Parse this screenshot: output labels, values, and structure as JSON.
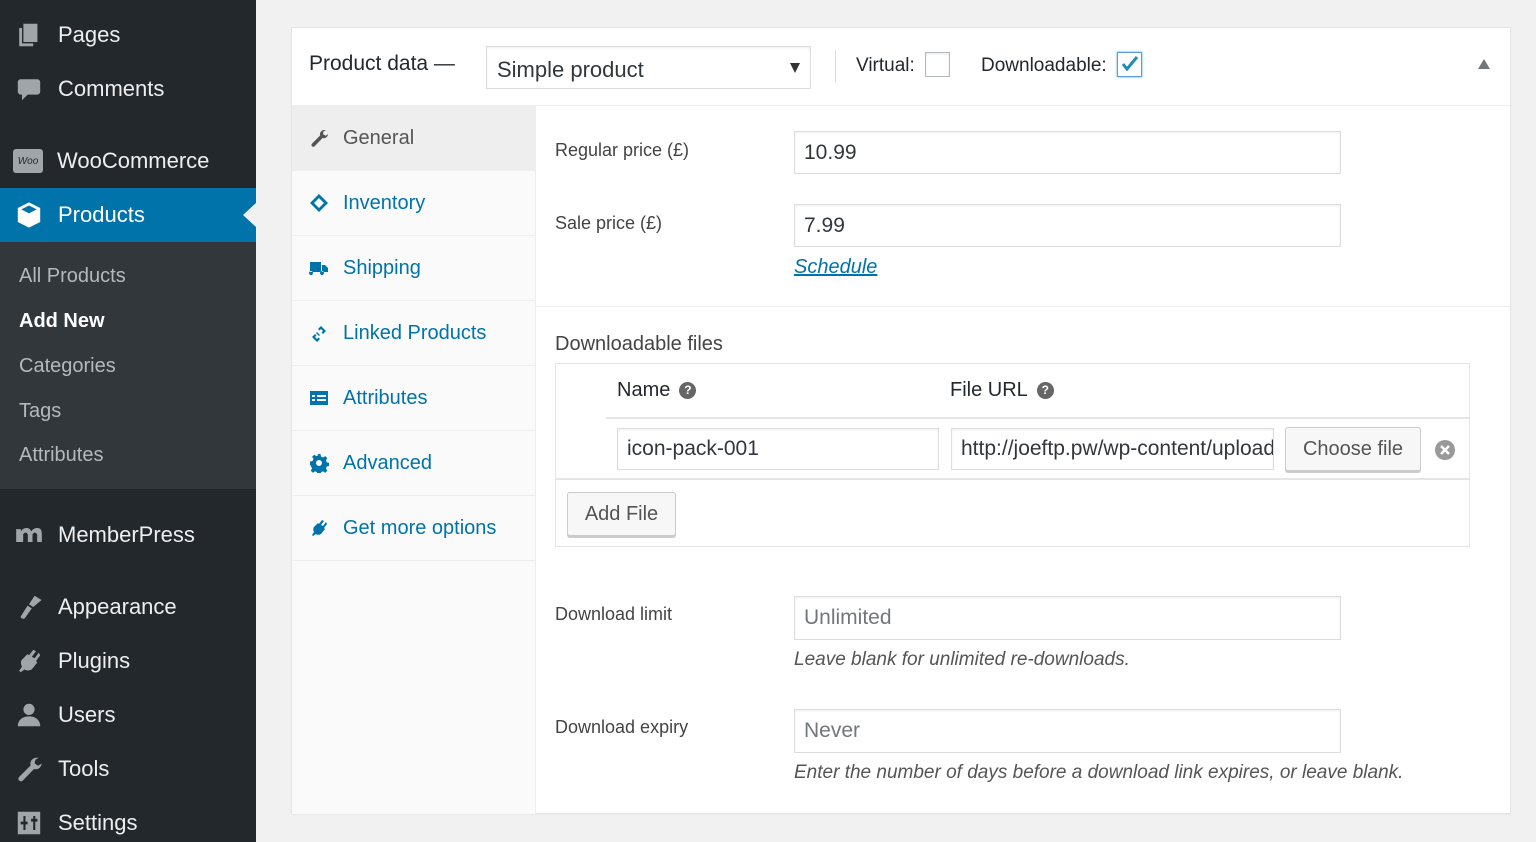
{
  "sidebar": {
    "items": [
      {
        "label": "Pages",
        "icon": "pages-icon"
      },
      {
        "label": "Comments",
        "icon": "comments-icon"
      },
      {
        "label": "WooCommerce",
        "icon": "woocommerce-icon"
      },
      {
        "label": "Products",
        "icon": "products-icon",
        "current": true
      },
      {
        "label": "MemberPress",
        "icon": "memberpress-icon"
      },
      {
        "label": "Appearance",
        "icon": "appearance-icon"
      },
      {
        "label": "Plugins",
        "icon": "plugins-icon"
      },
      {
        "label": "Users",
        "icon": "users-icon"
      },
      {
        "label": "Tools",
        "icon": "tools-icon"
      },
      {
        "label": "Settings",
        "icon": "settings-icon"
      }
    ],
    "woo_badge": "Woo",
    "submenu": [
      {
        "label": "All Products"
      },
      {
        "label": "Add New",
        "current": true
      },
      {
        "label": "Categories"
      },
      {
        "label": "Tags"
      },
      {
        "label": "Attributes"
      }
    ]
  },
  "product_data": {
    "title": "Product data —",
    "type_select": "Simple product",
    "virtual_label": "Virtual:",
    "virtual_checked": false,
    "downloadable_label": "Downloadable:",
    "downloadable_checked": true,
    "tabs": [
      {
        "label": "General",
        "icon": "wrench-icon",
        "active": true
      },
      {
        "label": "Inventory",
        "icon": "tag-icon"
      },
      {
        "label": "Shipping",
        "icon": "truck-icon"
      },
      {
        "label": "Linked Products",
        "icon": "link-icon"
      },
      {
        "label": "Attributes",
        "icon": "list-icon"
      },
      {
        "label": "Advanced",
        "icon": "gear-icon"
      },
      {
        "label": "Get more options",
        "icon": "plug-icon"
      }
    ],
    "general": {
      "regular_price_label": "Regular price (£)",
      "regular_price": "10.99",
      "sale_price_label": "Sale price (£)",
      "sale_price": "7.99",
      "schedule_link": "Schedule",
      "downloadable_files_label": "Downloadable files",
      "col_name": "Name",
      "col_file_url": "File URL",
      "help_glyph": "?",
      "files": [
        {
          "name": "icon-pack-001",
          "url": "http://joeftp.pw/wp-content/uploads/"
        }
      ],
      "choose_file_label": "Choose file",
      "add_file_label": "Add File",
      "download_limit_label": "Download limit",
      "download_limit_placeholder": "Unlimited",
      "download_limit_desc": "Leave blank for unlimited re-downloads.",
      "download_expiry_label": "Download expiry",
      "download_expiry_placeholder": "Never",
      "download_expiry_desc": "Enter the number of days before a download link expires, or leave blank."
    }
  },
  "colors": {
    "accent": "#0073aa",
    "sidebar_bg": "#23282d",
    "submenu_bg": "#32373c"
  }
}
